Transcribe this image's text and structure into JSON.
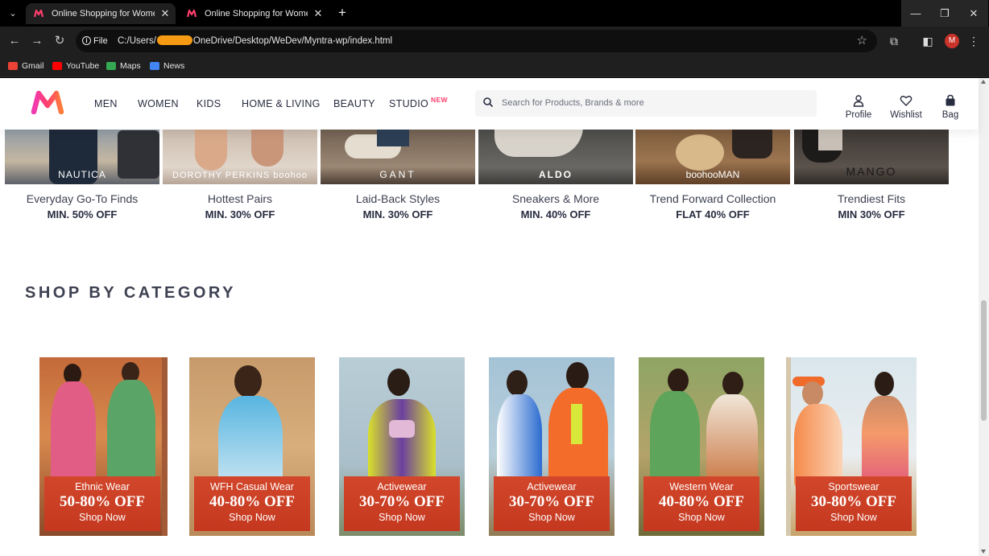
{
  "browser": {
    "tabs": [
      {
        "title": "Online Shopping for Women, M",
        "active": true
      },
      {
        "title": "Online Shopping for Women, M",
        "active": false
      }
    ],
    "new_tab": "+",
    "window_controls": {
      "minimize": "—",
      "restore": "❐",
      "close": "✕"
    },
    "nav": {
      "back": "←",
      "forward": "→",
      "reload": "↻"
    },
    "site_info": "File",
    "url_prefix": "C:/Users/",
    "url_suffix": "OneDrive/Desktop/WeDev/Myntra-wp/index.html",
    "profile_initial": "M",
    "bookmarks": [
      {
        "label": "Gmail",
        "color": "#ea4335"
      },
      {
        "label": "YouTube",
        "color": "#ff0000"
      },
      {
        "label": "Maps",
        "color": "#34a853"
      },
      {
        "label": "News",
        "color": "#4285f4"
      }
    ]
  },
  "header": {
    "nav": [
      "MEN",
      "WOMEN",
      "KIDS",
      "HOME & LIVING",
      "BEAUTY",
      "STUDIO"
    ],
    "studio_badge": "NEW",
    "search_placeholder": "Search for Products, Brands & more",
    "actions": [
      "Profile",
      "Wishlist",
      "Bag"
    ]
  },
  "brands": [
    {
      "logo": "NAUTICA",
      "caption": "Everyday Go-To Finds",
      "offer": "MIN. 50% OFF"
    },
    {
      "logo": "DOROTHY PERKINS  boohoo",
      "caption": "Hottest Pairs",
      "offer": "MIN. 30% OFF"
    },
    {
      "logo": "GANT",
      "caption": "Laid-Back Styles",
      "offer": "MIN. 30% OFF"
    },
    {
      "logo": "ALDO",
      "caption": "Sneakers & More",
      "offer": "MIN. 40% OFF"
    },
    {
      "logo": "boohooMAN",
      "caption": "Trend Forward Collection",
      "offer": "FLAT 40% OFF"
    },
    {
      "logo": "MANGO",
      "caption": "Trendiest Fits",
      "offer": "MIN 30% OFF"
    }
  ],
  "section_title": "SHOP BY CATEGORY",
  "categories": [
    {
      "name": "Ethnic Wear",
      "offer": "50-80% OFF",
      "cta": "Shop Now"
    },
    {
      "name": "WFH Casual Wear",
      "offer": "40-80% OFF",
      "cta": "Shop Now"
    },
    {
      "name": "Activewear",
      "offer": "30-70% OFF",
      "cta": "Shop Now"
    },
    {
      "name": "Activewear",
      "offer": "30-70% OFF",
      "cta": "Shop Now"
    },
    {
      "name": "Western Wear",
      "offer": "40-80% OFF",
      "cta": "Shop Now"
    },
    {
      "name": "Sportswear",
      "offer": "30-80% OFF",
      "cta": "Shop Now"
    }
  ],
  "colors": {
    "brand_pink": "#ff3f6c",
    "banner_orange": "#c9401f",
    "text_dark": "#282c3f"
  }
}
